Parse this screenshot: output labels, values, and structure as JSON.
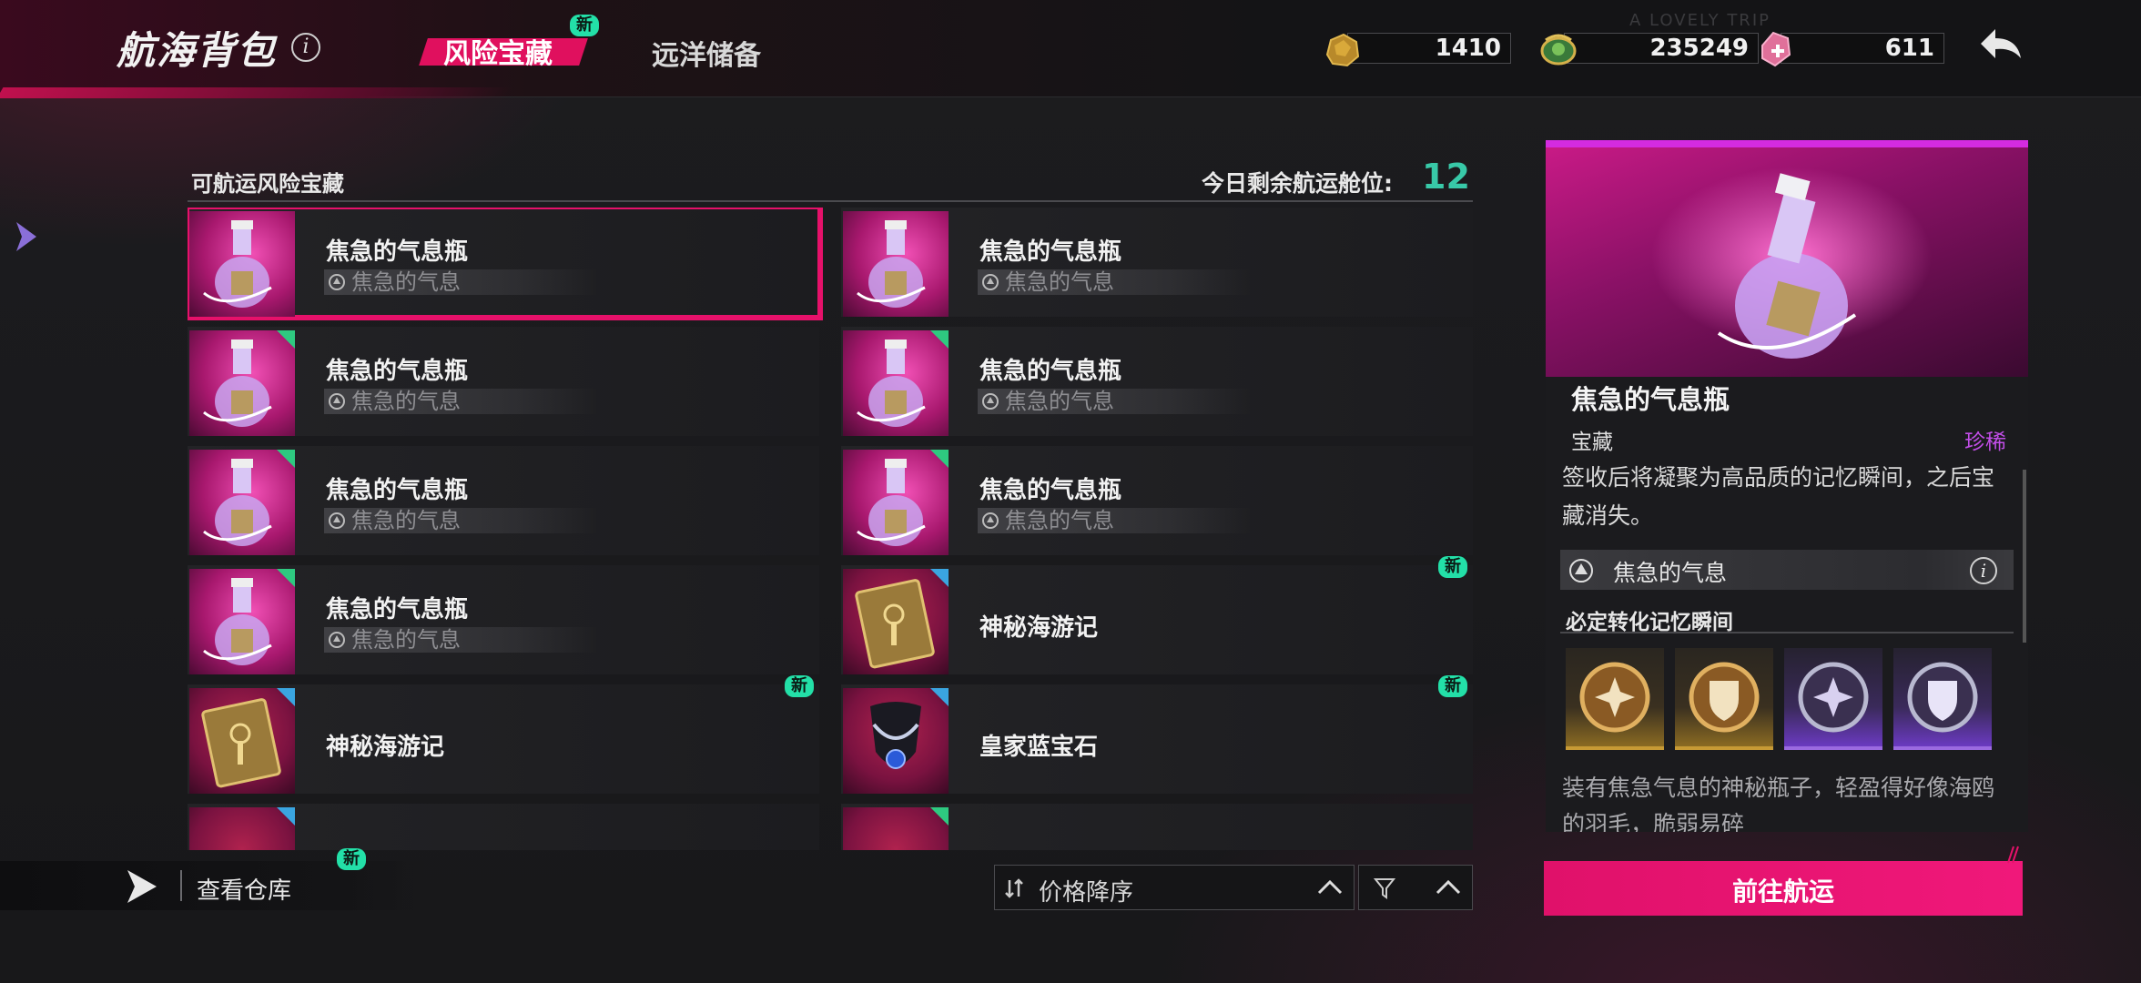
{
  "header": {
    "title": "航海背包",
    "tabs": [
      {
        "label": "风险宝藏",
        "badge": "新",
        "active": true
      },
      {
        "label": "远洋储备",
        "active": false
      }
    ],
    "currencies": [
      {
        "icon": "gold-ore-icon",
        "value": "1410"
      },
      {
        "icon": "jade-dragon-icon",
        "value": "235249"
      },
      {
        "icon": "pink-crystal-icon",
        "value": "611"
      }
    ],
    "watermark": "A LOVELY TRIP"
  },
  "list": {
    "title": "可航运风险宝藏",
    "slots_label": "今日剩余航运舱位:",
    "slots_value": "12",
    "items": [
      {
        "name": "焦急的气息瓶",
        "sub": "焦急的气息",
        "thumb": "potion-bottle-icon",
        "selected": true
      },
      {
        "name": "焦急的气息瓶",
        "sub": "焦急的气息",
        "thumb": "potion-bottle-icon"
      },
      {
        "name": "焦急的气息瓶",
        "sub": "焦急的气息",
        "thumb": "potion-bottle-icon"
      },
      {
        "name": "焦急的气息瓶",
        "sub": "焦急的气息",
        "thumb": "potion-bottle-icon"
      },
      {
        "name": "焦急的气息瓶",
        "sub": "焦急的气息",
        "thumb": "potion-bottle-icon"
      },
      {
        "name": "焦急的气息瓶",
        "sub": "焦急的气息",
        "thumb": "potion-bottle-icon"
      },
      {
        "name": "焦急的气息瓶",
        "sub": "焦急的气息",
        "thumb": "potion-bottle-icon"
      },
      {
        "name": "神秘海游记",
        "thumb": "mystery-book-icon",
        "badge": "新"
      },
      {
        "name": "神秘海游记",
        "thumb": "mystery-book-icon",
        "badge": "新"
      },
      {
        "name": "皇家蓝宝石",
        "thumb": "sapphire-necklace-icon",
        "badge": "新"
      }
    ]
  },
  "bottom": {
    "warehouse_label": "查看仓库",
    "warehouse_badge": "新",
    "sort_label": "价格降序"
  },
  "detail": {
    "name": "焦急的气息瓶",
    "type": "宝藏",
    "rarity": "珍稀",
    "description": "签收后将凝聚为高品质的记忆瞬间，之后宝藏消失。",
    "aura": "焦急的气息",
    "conversion_title": "必定转化记忆瞬间",
    "memories": [
      {
        "icon": "gold-sparkle-emblem-icon",
        "tier": "gold"
      },
      {
        "icon": "gold-shield-emblem-icon",
        "tier": "gold"
      },
      {
        "icon": "purple-sparkle-emblem-icon",
        "tier": "purple"
      },
      {
        "icon": "purple-shield-emblem-icon",
        "tier": "purple"
      }
    ],
    "flavor": "装有焦急气息的神秘瓶子，轻盈得好像海鸥的羽毛，脆弱易碎",
    "go_button": "前往航运"
  },
  "colors": {
    "accent": "#e6116a",
    "slots": "#38c9a8",
    "new_badge": "#23e0a8",
    "rarity": "#c24ee8"
  }
}
